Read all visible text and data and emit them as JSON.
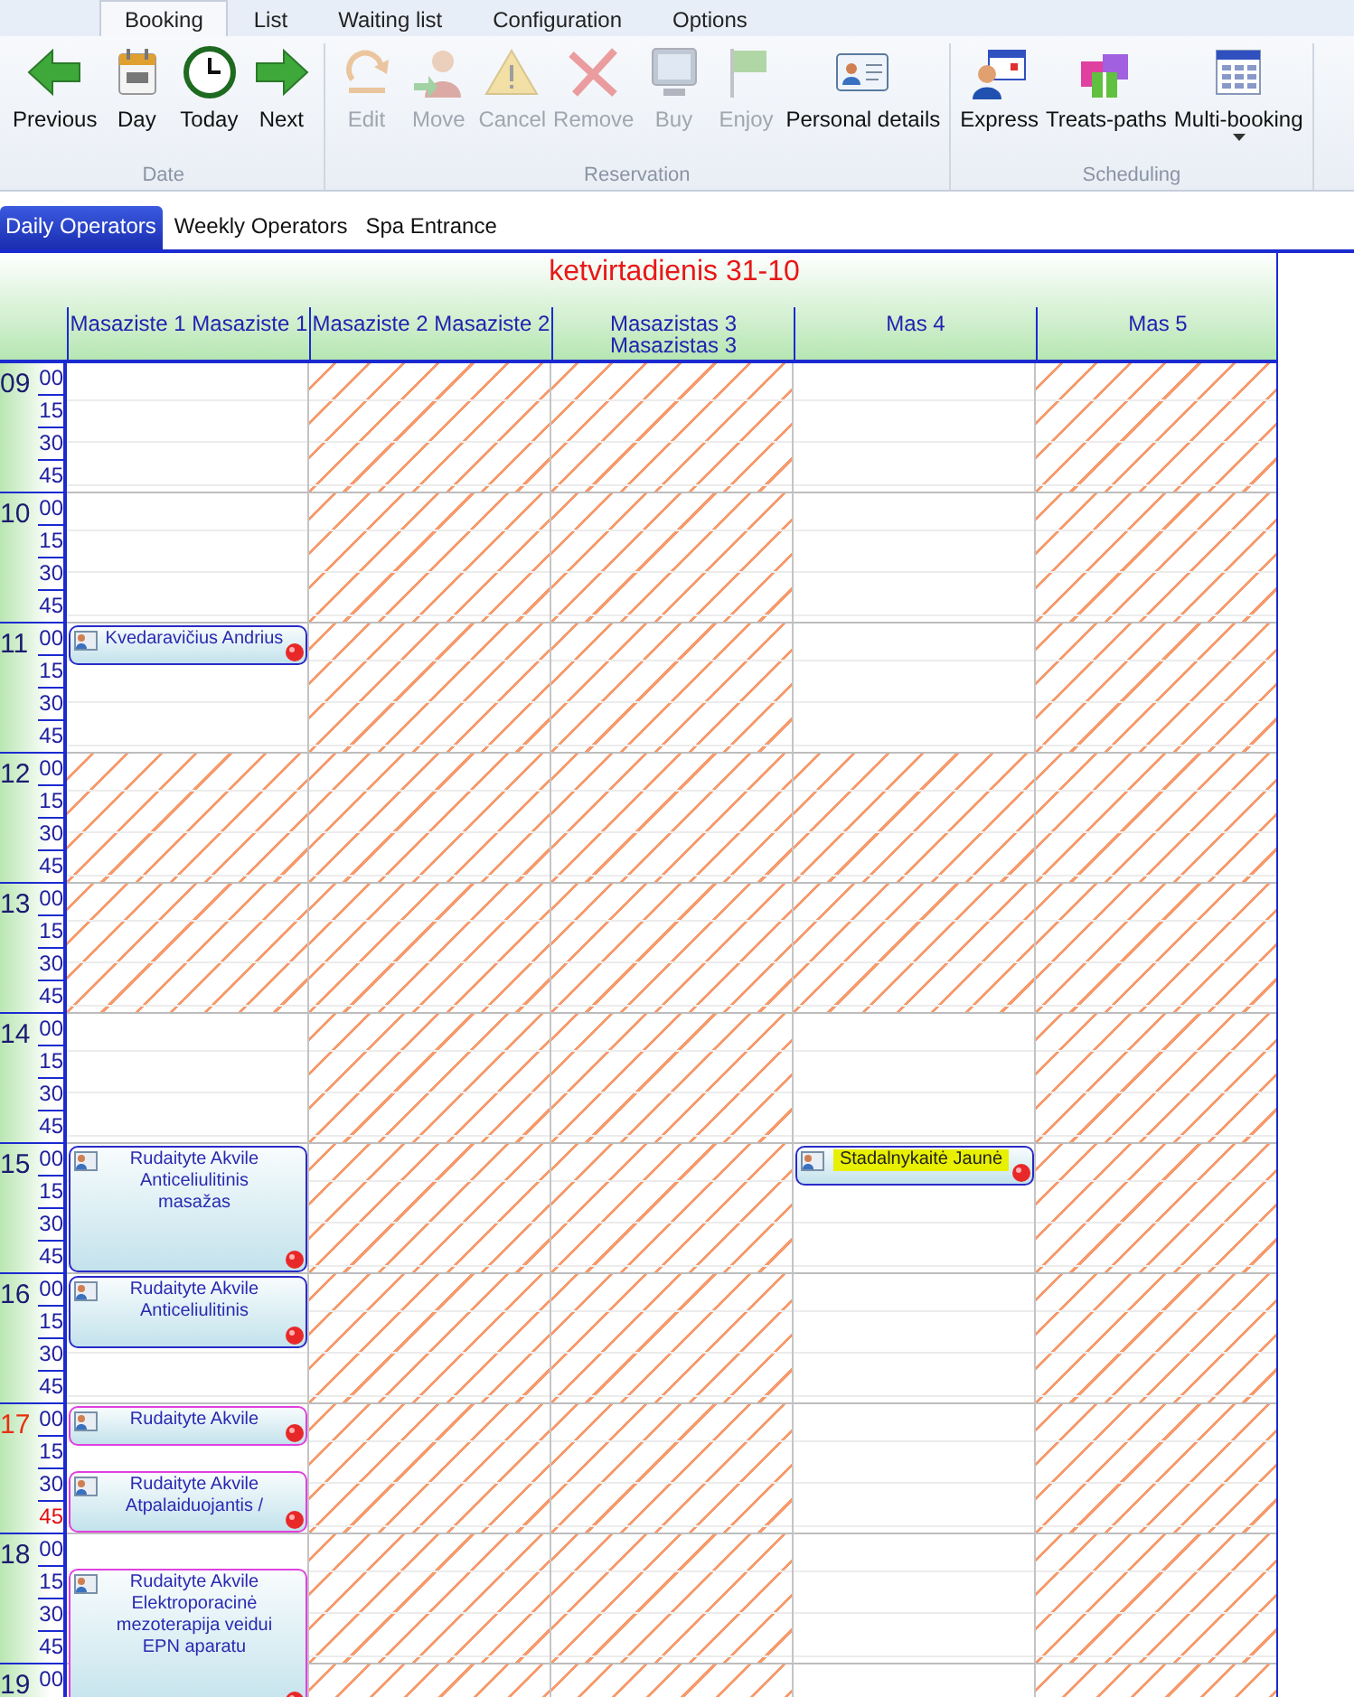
{
  "ribbon_tabs": [
    {
      "label": "Booking",
      "selected": true
    },
    {
      "label": "List",
      "selected": false
    },
    {
      "label": "Waiting list",
      "selected": false
    },
    {
      "label": "Configuration",
      "selected": false
    },
    {
      "label": "Options",
      "selected": false
    }
  ],
  "ribbon_groups": [
    {
      "title": "Date",
      "buttons": [
        {
          "label": "Previous",
          "kind": "back",
          "disabled": false
        },
        {
          "label": "Day",
          "kind": "calendar",
          "disabled": false
        },
        {
          "label": "Today",
          "kind": "clock",
          "disabled": false
        },
        {
          "label": "Next",
          "kind": "forward",
          "disabled": false
        }
      ]
    },
    {
      "title": "Reservation",
      "buttons": [
        {
          "label": "Edit",
          "kind": "undo",
          "disabled": true
        },
        {
          "label": "Move",
          "kind": "person",
          "disabled": true
        },
        {
          "label": "Cancel",
          "kind": "warning",
          "disabled": true
        },
        {
          "label": "Remove",
          "kind": "cross",
          "disabled": true
        },
        {
          "label": "Buy",
          "kind": "monitor",
          "disabled": true
        },
        {
          "label": "Enjoy",
          "kind": "flag",
          "disabled": true
        },
        {
          "label": "Personal details",
          "kind": "card",
          "disabled": false
        }
      ]
    },
    {
      "title": "Scheduling",
      "buttons": [
        {
          "label": "Express",
          "kind": "express",
          "disabled": false
        },
        {
          "label": "Treats-paths",
          "kind": "boxes",
          "disabled": false
        },
        {
          "label": "Multi-booking",
          "kind": "grid",
          "disabled": false,
          "dropdown": true
        }
      ]
    }
  ],
  "view_tabs": [
    {
      "label": "Daily Operators",
      "selected": true
    },
    {
      "label": "Weekly Operators",
      "selected": false
    },
    {
      "label": "Spa Entrance",
      "selected": false
    }
  ],
  "calendar": {
    "title": "ketvirtadienis 31-10",
    "columns": [
      {
        "name": "Masaziste 1 Masaziste 1",
        "events": [
          {
            "lines": [
              "Kvedaravičius Andrius"
            ],
            "color": "#2a2ac8",
            "highlighted": false
          },
          {
            "lines": [
              "Rudaityte Akvile",
              "Anticeliulitinis masažas"
            ],
            "color": "#2a2ac8",
            "highlighted": false
          },
          {
            "lines": [
              "Rudaityte Akvile",
              "Anticeliulitinis"
            ],
            "color": "#2a2ac8",
            "highlighted": false
          },
          {
            "lines": [
              "Rudaityte Akvile"
            ],
            "color": "#e040e0",
            "highlighted": false
          },
          {
            "lines": [
              "Rudaityte Akvile",
              "Atpalaiduojantis /"
            ],
            "color": "#e040e0",
            "highlighted": false
          },
          {
            "lines": [
              "Rudaityte Akvile",
              "Elektroporacinė mezoterapija veidui EPN aparatu"
            ],
            "color": "#e040e0",
            "highlighted": false
          }
        ]
      },
      {
        "name": "Masaziste 2 Masaziste 2"
      },
      {
        "name": "Masazistas 3 Masazistas 3"
      },
      {
        "name": "Mas 4",
        "events": [
          {
            "lines": [
              "Stadalnykaitė Jaunė"
            ],
            "color": "#2a2ac8",
            "highlighted": true
          }
        ]
      },
      {
        "name": "Mas 5"
      }
    ],
    "hours": [
      {
        "hour": "09",
        "color": "#1c1c70",
        "minutes": [
          {
            "label": "00",
            "color": "#2020a0"
          },
          {
            "label": "15",
            "color": "#2020a0"
          },
          {
            "label": "30",
            "color": "#2020a0"
          },
          {
            "label": "45",
            "color": "#2020a0"
          }
        ],
        "blocked": [
          false,
          true,
          true,
          false,
          true
        ]
      },
      {
        "hour": "10",
        "color": "#1c1c70",
        "minutes": [
          {
            "label": "00",
            "color": "#2020a0"
          },
          {
            "label": "15",
            "color": "#2020a0"
          },
          {
            "label": "30",
            "color": "#2020a0"
          },
          {
            "label": "45",
            "color": "#2020a0"
          }
        ],
        "blocked": [
          false,
          true,
          true,
          false,
          true
        ]
      },
      {
        "hour": "11",
        "color": "#1c1c70",
        "minutes": [
          {
            "label": "00",
            "color": "#2020a0"
          },
          {
            "label": "15",
            "color": "#2020a0"
          },
          {
            "label": "30",
            "color": "#2020a0"
          },
          {
            "label": "45",
            "color": "#2020a0"
          }
        ],
        "blocked": [
          false,
          true,
          true,
          false,
          true
        ]
      },
      {
        "hour": "12",
        "color": "#1c1c70",
        "minutes": [
          {
            "label": "00",
            "color": "#2020a0"
          },
          {
            "label": "15",
            "color": "#2020a0"
          },
          {
            "label": "30",
            "color": "#2020a0"
          },
          {
            "label": "45",
            "color": "#2020a0"
          }
        ],
        "blocked": [
          true,
          true,
          true,
          true,
          true
        ]
      },
      {
        "hour": "13",
        "color": "#1c1c70",
        "minutes": [
          {
            "label": "00",
            "color": "#2020a0"
          },
          {
            "label": "15",
            "color": "#2020a0"
          },
          {
            "label": "30",
            "color": "#2020a0"
          },
          {
            "label": "45",
            "color": "#2020a0"
          }
        ],
        "blocked": [
          true,
          true,
          true,
          true,
          true
        ]
      },
      {
        "hour": "14",
        "color": "#1c1c70",
        "minutes": [
          {
            "label": "00",
            "color": "#2020a0"
          },
          {
            "label": "15",
            "color": "#2020a0"
          },
          {
            "label": "30",
            "color": "#2020a0"
          },
          {
            "label": "45",
            "color": "#2020a0"
          }
        ],
        "blocked": [
          false,
          true,
          true,
          false,
          true
        ]
      },
      {
        "hour": "15",
        "color": "#1c1c70",
        "minutes": [
          {
            "label": "00",
            "color": "#2020a0"
          },
          {
            "label": "15",
            "color": "#2020a0"
          },
          {
            "label": "30",
            "color": "#2020a0"
          },
          {
            "label": "45",
            "color": "#2020a0"
          }
        ],
        "blocked": [
          false,
          true,
          true,
          false,
          true
        ]
      },
      {
        "hour": "16",
        "color": "#1c1c70",
        "minutes": [
          {
            "label": "00",
            "color": "#2020a0"
          },
          {
            "label": "15",
            "color": "#2020a0"
          },
          {
            "label": "30",
            "color": "#2020a0"
          },
          {
            "label": "45",
            "color": "#2020a0"
          }
        ],
        "blocked": [
          false,
          true,
          true,
          false,
          true
        ]
      },
      {
        "hour": "17",
        "color": "#e83010",
        "minutes": [
          {
            "label": "00",
            "color": "#2020a0"
          },
          {
            "label": "15",
            "color": "#2020a0"
          },
          {
            "label": "30",
            "color": "#2020a0"
          },
          {
            "label": "45",
            "color": "#e01010"
          }
        ],
        "blocked": [
          false,
          true,
          true,
          false,
          true
        ]
      },
      {
        "hour": "18",
        "color": "#1c1c70",
        "minutes": [
          {
            "label": "00",
            "color": "#2020a0"
          },
          {
            "label": "15",
            "color": "#2020a0"
          },
          {
            "label": "30",
            "color": "#2020a0"
          },
          {
            "label": "45",
            "color": "#2020a0"
          }
        ],
        "blocked": [
          false,
          true,
          true,
          false,
          true
        ]
      },
      {
        "hour": "19",
        "color": "#1c1c70",
        "minutes": [
          {
            "label": "00",
            "color": "#2020a0"
          }
        ],
        "blocked": [
          false,
          true,
          true,
          false,
          true
        ]
      }
    ]
  }
}
